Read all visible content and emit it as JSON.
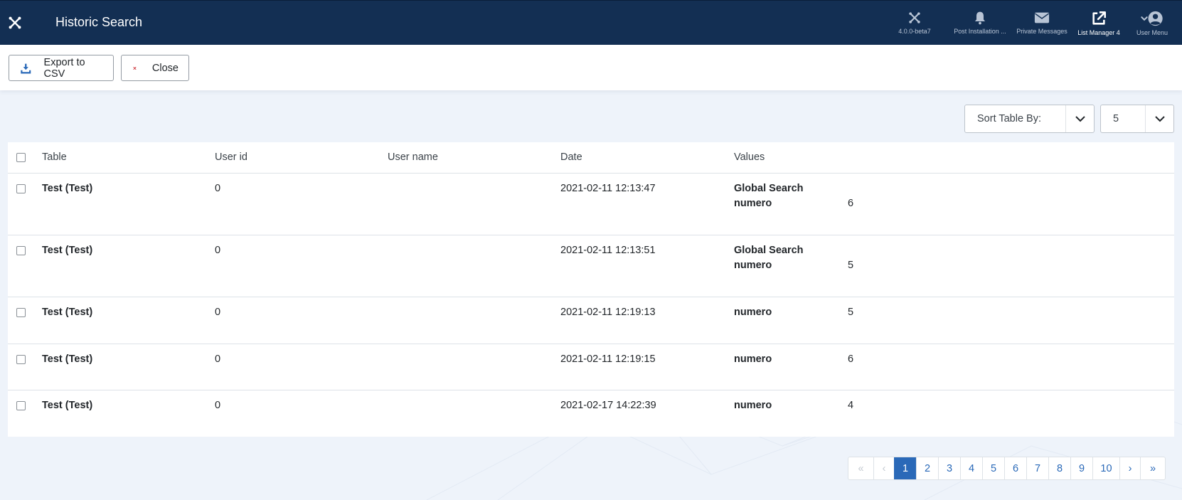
{
  "header": {
    "title": "Historic Search",
    "items": [
      {
        "label": "4.0.0-beta7",
        "icon": "joomla-icon"
      },
      {
        "label": "Post Installation ...",
        "icon": "bell-icon"
      },
      {
        "label": "Private Messages",
        "icon": "envelope-icon"
      },
      {
        "label": "List Manager 4",
        "icon": "external-link-icon"
      },
      {
        "label": "User Menu",
        "icon": "user-circle-icon"
      }
    ]
  },
  "toolbar": {
    "export_label": "Export to CSV",
    "close_label": "Close"
  },
  "filters": {
    "sort_label": "Sort Table By:",
    "limit_value": "5"
  },
  "table": {
    "headers": [
      "Table",
      "User id",
      "User name",
      "Date",
      "Values"
    ],
    "rows": [
      {
        "table": "Test (Test)",
        "user_id": "0",
        "user_name": "",
        "date": "2021-02-11 12:13:47",
        "values": [
          {
            "key": "Global Search",
            "value": ""
          },
          {
            "key": "numero",
            "value": "6"
          }
        ]
      },
      {
        "table": "Test (Test)",
        "user_id": "0",
        "user_name": "",
        "date": "2021-02-11 12:13:51",
        "values": [
          {
            "key": "Global Search",
            "value": ""
          },
          {
            "key": "numero",
            "value": "5"
          }
        ]
      },
      {
        "table": "Test (Test)",
        "user_id": "0",
        "user_name": "",
        "date": "2021-02-11 12:19:13",
        "values": [
          {
            "key": "numero",
            "value": "5"
          }
        ]
      },
      {
        "table": "Test (Test)",
        "user_id": "0",
        "user_name": "",
        "date": "2021-02-11 12:19:15",
        "values": [
          {
            "key": "numero",
            "value": "6"
          }
        ]
      },
      {
        "table": "Test (Test)",
        "user_id": "0",
        "user_name": "",
        "date": "2021-02-17 14:22:39",
        "values": [
          {
            "key": "numero",
            "value": "4"
          }
        ]
      }
    ]
  },
  "pagination": {
    "first": "«",
    "prev": "‹",
    "pages": [
      "1",
      "2",
      "3",
      "4",
      "5",
      "6",
      "7",
      "8",
      "9",
      "10"
    ],
    "current": "1",
    "next": "›",
    "last": "»"
  },
  "colors": {
    "header_bg": "#132f53",
    "accent": "#2a69b8",
    "close_icon": "#c81d25",
    "export_icon": "#2a69b8"
  }
}
